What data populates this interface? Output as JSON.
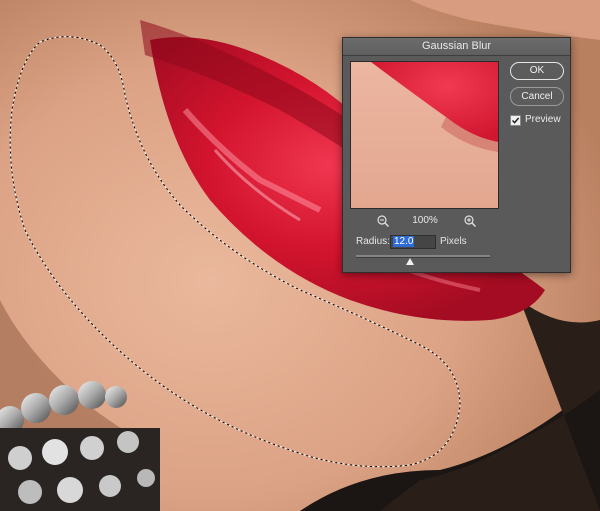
{
  "dialog": {
    "title": "Gaussian Blur",
    "ok_label": "OK",
    "cancel_label": "Cancel",
    "preview_label": "Preview",
    "preview_checked": true,
    "zoom_level": "100%",
    "radius_label": "Radius:",
    "radius_value": "12.0",
    "radius_units": "Pixels",
    "zoom_out_icon": "zoom-out-icon",
    "zoom_in_icon": "zoom-in-icon"
  },
  "colors": {
    "skin": "#d9a081",
    "lips": "#c5102a",
    "dialog_bg": "#5a5a5a",
    "selection_highlight": "#2f6bd6"
  }
}
